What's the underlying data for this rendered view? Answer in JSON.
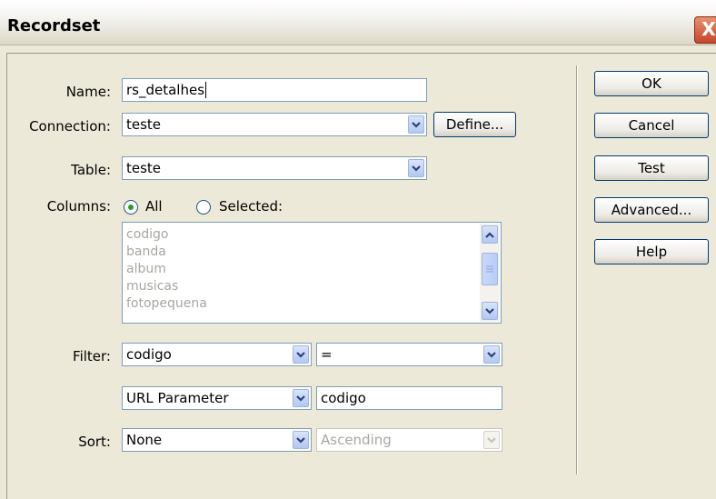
{
  "dialog": {
    "title": "Recordset",
    "close_symbol": "X"
  },
  "fields": {
    "name_label": "Name:",
    "name_value": "rs_detalhes",
    "connection_label": "Connection:",
    "connection_value": "teste",
    "define_button": "Define...",
    "table_label": "Table:",
    "table_value": "teste",
    "columns_label": "Columns:",
    "columns_all_label": "All",
    "columns_selected_label": "Selected:",
    "columns_mode": "All",
    "columns_list": [
      "codigo",
      "banda",
      "album",
      "musicas",
      "fotopequena"
    ],
    "filter_label": "Filter:",
    "filter_column": "codigo",
    "filter_operator": "=",
    "filter_param_type": "URL Parameter",
    "filter_param_value": "codigo",
    "sort_label": "Sort:",
    "sort_column": "None",
    "sort_order": "Ascending"
  },
  "buttons": {
    "ok": "OK",
    "cancel": "Cancel",
    "test": "Test",
    "advanced": "Advanced...",
    "help": "Help"
  },
  "colors": {
    "dialog_bg": "#ece9d8",
    "input_border": "#7f9db9",
    "disabled_text": "#a7a6a0",
    "close_button": "#c6462c"
  },
  "icons": {
    "dropdown": "chevron-down-icon",
    "scroll_up": "chevron-up-icon",
    "scroll_down": "chevron-down-icon",
    "close": "close-icon"
  }
}
